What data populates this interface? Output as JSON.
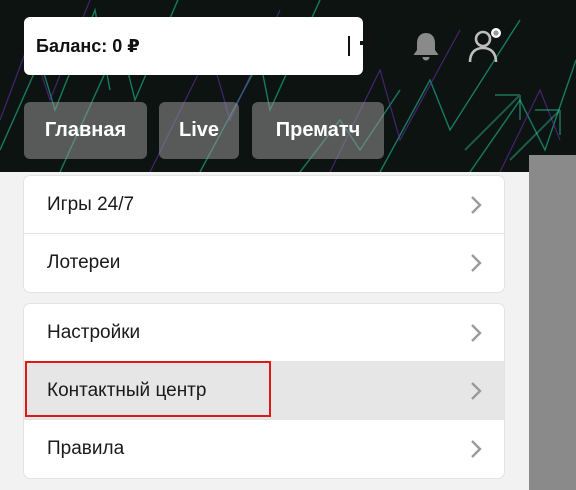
{
  "header": {
    "balance_label": "Баланс: 0 ₽",
    "icons": {
      "add": "plus-icon",
      "notifications": "bell-icon",
      "profile": "user-icon"
    },
    "colors": {
      "background": "#0d1311",
      "accent_green": "#1fd1a0",
      "accent_purple": "#6b2fb3"
    }
  },
  "tabs": [
    {
      "label": "Главная"
    },
    {
      "label": "Live"
    },
    {
      "label": "Прематч"
    }
  ],
  "menu": {
    "group1": [
      {
        "label": "Игры 24/7"
      },
      {
        "label": "Лотереи"
      }
    ],
    "group2": [
      {
        "label": "Настройки"
      },
      {
        "label": "Контактный центр"
      },
      {
        "label": "Правила"
      }
    ],
    "highlighted_item": "Контактный центр"
  }
}
